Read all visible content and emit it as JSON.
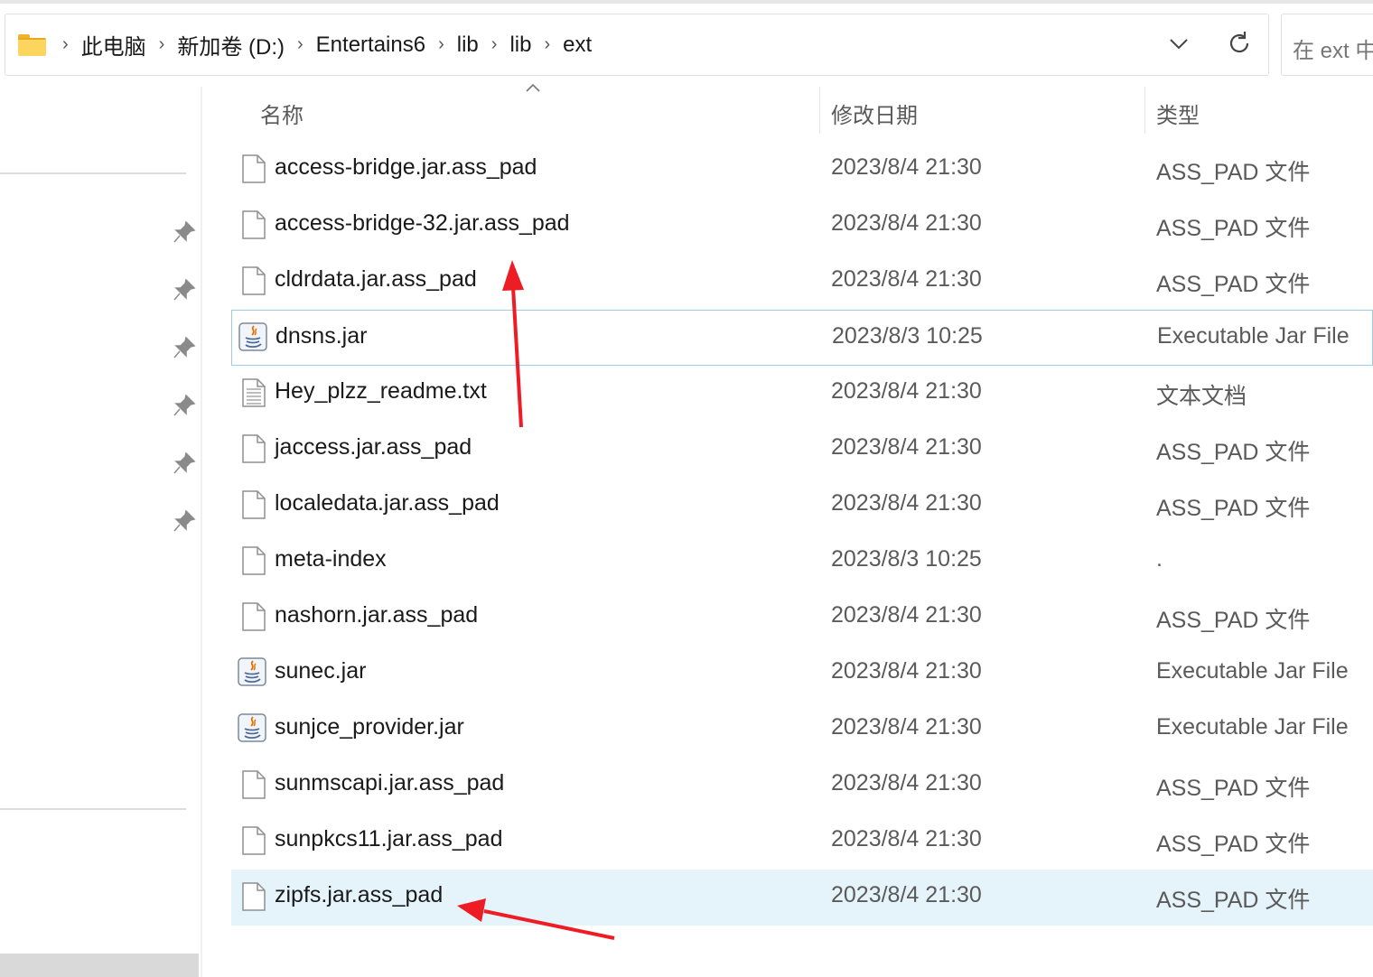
{
  "address_bar": {
    "breadcrumbs": [
      "此电脑",
      "新加卷 (D:)",
      "Entertains6",
      "lib",
      "lib",
      "ext"
    ],
    "dropdown_icon": "chevron-down-icon",
    "refresh_icon": "refresh-icon"
  },
  "search": {
    "placeholder": "在 ext 中"
  },
  "columns": {
    "name": "名称",
    "modified": "修改日期",
    "type": "类型"
  },
  "files": [
    {
      "name": "access-bridge.jar.ass_pad",
      "modified": "2023/8/4 21:30",
      "type": "ASS_PAD 文件",
      "icon": "blank-file-icon"
    },
    {
      "name": "access-bridge-32.jar.ass_pad",
      "modified": "2023/8/4 21:30",
      "type": "ASS_PAD 文件",
      "icon": "blank-file-icon"
    },
    {
      "name": "cldrdata.jar.ass_pad",
      "modified": "2023/8/4 21:30",
      "type": "ASS_PAD 文件",
      "icon": "blank-file-icon"
    },
    {
      "name": "dnsns.jar",
      "modified": "2023/8/3 10:25",
      "type": "Executable Jar File",
      "icon": "java-jar-icon"
    },
    {
      "name": "Hey_plzz_readme.txt",
      "modified": "2023/8/4 21:30",
      "type": "文本文档",
      "icon": "text-file-icon"
    },
    {
      "name": "jaccess.jar.ass_pad",
      "modified": "2023/8/4 21:30",
      "type": "ASS_PAD 文件",
      "icon": "blank-file-icon"
    },
    {
      "name": "localedata.jar.ass_pad",
      "modified": "2023/8/4 21:30",
      "type": "ASS_PAD 文件",
      "icon": "blank-file-icon"
    },
    {
      "name": "meta-index",
      "modified": "2023/8/3 10:25",
      "type": ".",
      "icon": "blank-file-icon"
    },
    {
      "name": "nashorn.jar.ass_pad",
      "modified": "2023/8/4 21:30",
      "type": "ASS_PAD 文件",
      "icon": "blank-file-icon"
    },
    {
      "name": "sunec.jar",
      "modified": "2023/8/4 21:30",
      "type": "Executable Jar File",
      "icon": "java-jar-icon"
    },
    {
      "name": "sunjce_provider.jar",
      "modified": "2023/8/4 21:30",
      "type": "Executable Jar File",
      "icon": "java-jar-icon"
    },
    {
      "name": "sunmscapi.jar.ass_pad",
      "modified": "2023/8/4 21:30",
      "type": "ASS_PAD 文件",
      "icon": "blank-file-icon"
    },
    {
      "name": "sunpkcs11.jar.ass_pad",
      "modified": "2023/8/4 21:30",
      "type": "ASS_PAD 文件",
      "icon": "blank-file-icon"
    },
    {
      "name": "zipfs.jar.ass_pad",
      "modified": "2023/8/4 21:30",
      "type": "ASS_PAD 文件",
      "icon": "blank-file-icon"
    }
  ],
  "sidebar": {
    "pin_icon": "pin-icon",
    "pinned_count": 6
  },
  "colors": {
    "annotation_arrow": "#ee1c25",
    "selection_fill": "#e5f3fb",
    "focus_outline": "#99cde8"
  }
}
